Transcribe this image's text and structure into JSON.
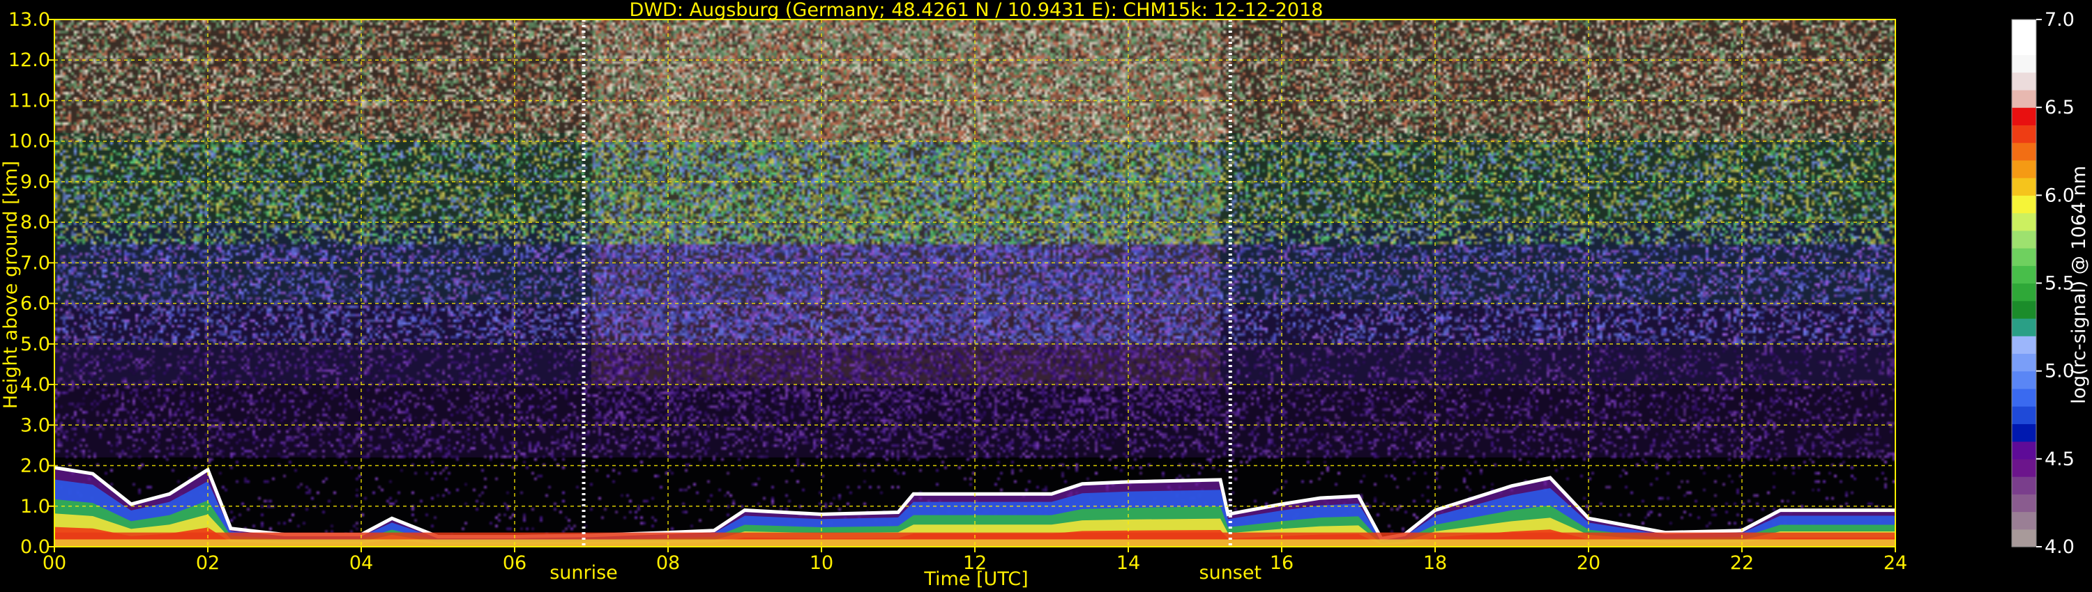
{
  "chart_data": {
    "type": "heatmap",
    "title": "DWD: Augsburg (Germany; 48.4261 N / 10.9431 E):    CHM15k: 12-12-2018",
    "xlabel": "Time [UTC]",
    "ylabel": "Height above ground [km]",
    "xlim": [
      0,
      24
    ],
    "ylim": [
      0,
      13
    ],
    "x_ticks": [
      "00",
      "02",
      "04",
      "06",
      "08",
      "10",
      "12",
      "14",
      "16",
      "18",
      "20",
      "22",
      "24"
    ],
    "y_ticks": [
      "0.0",
      "1.0",
      "2.0",
      "3.0",
      "4.0",
      "5.0",
      "6.0",
      "7.0",
      "8.0",
      "9.0",
      "10.0",
      "11.0",
      "12.0",
      "13.0"
    ],
    "grid": true,
    "markers": [
      {
        "label": "sunrise",
        "x": 6.9
      },
      {
        "label": "sunset",
        "x": 15.33
      }
    ],
    "colorbar": {
      "label": "log(rc-signal) @ 1064 nm",
      "range": [
        4.0,
        7.0
      ],
      "ticks": [
        "4.0",
        "4.5",
        "5.0",
        "5.5",
        "6.0",
        "6.5",
        "7.0"
      ],
      "colors": [
        "#a89a9a",
        "#9a7f95",
        "#8a5c8f",
        "#7a3e8c",
        "#6c158c",
        "#5e0b98",
        "#0019b0",
        "#1f4ad8",
        "#3a6af0",
        "#5a86f5",
        "#7a9ef8",
        "#9cb6fb",
        "#2a9f86",
        "#1b8c2a",
        "#2fa838",
        "#48be4a",
        "#6fd05f",
        "#9ee16f",
        "#ccf060",
        "#f6f438",
        "#f5c41c",
        "#f59a14",
        "#f26e14",
        "#ee3d14",
        "#e81010",
        "#e7b8b0",
        "#ecdcdc",
        "#f7f7f7",
        "#ffffff",
        "#ffffff"
      ]
    },
    "mixing_layer_km": [
      [
        0.0,
        1.95
      ],
      [
        0.5,
        1.8
      ],
      [
        1.0,
        1.05
      ],
      [
        1.5,
        1.3
      ],
      [
        2.0,
        1.9
      ],
      [
        2.3,
        0.45
      ],
      [
        3.0,
        0.3
      ],
      [
        4.0,
        0.3
      ],
      [
        4.4,
        0.7
      ],
      [
        5.0,
        0.25
      ],
      [
        6.0,
        0.25
      ],
      [
        7.0,
        0.28
      ],
      [
        8.0,
        0.35
      ],
      [
        8.6,
        0.4
      ],
      [
        9.0,
        0.9
      ],
      [
        10.0,
        0.8
      ],
      [
        11.0,
        0.85
      ],
      [
        11.2,
        1.3
      ],
      [
        13.0,
        1.3
      ],
      [
        13.4,
        1.55
      ],
      [
        14.0,
        1.6
      ],
      [
        15.2,
        1.65
      ],
      [
        15.3,
        0.8
      ],
      [
        16.0,
        1.05
      ],
      [
        16.5,
        1.2
      ],
      [
        17.0,
        1.25
      ],
      [
        17.3,
        0.2
      ],
      [
        17.6,
        0.3
      ],
      [
        18.0,
        0.9
      ],
      [
        19.0,
        1.5
      ],
      [
        19.5,
        1.7
      ],
      [
        20.0,
        0.7
      ],
      [
        21.0,
        0.35
      ],
      [
        22.0,
        0.4
      ],
      [
        22.5,
        0.9
      ],
      [
        24.0,
        0.9
      ]
    ]
  }
}
